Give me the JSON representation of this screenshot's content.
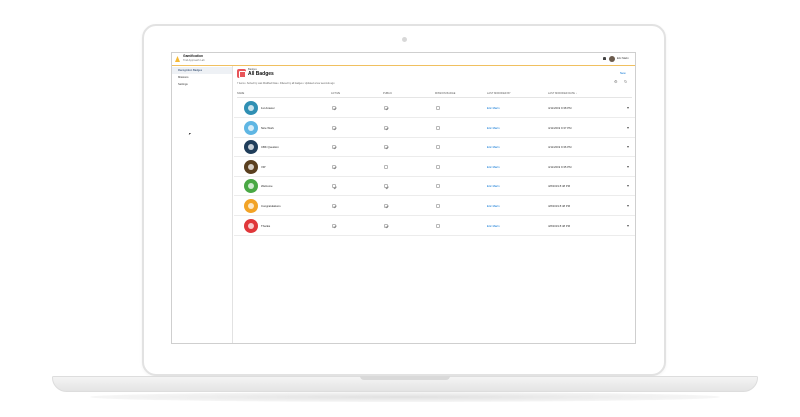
{
  "app": {
    "title": "Gamification",
    "subtitle": "Trail Approach Lab"
  },
  "header": {
    "user_name": "Eric Marin"
  },
  "sidebar": {
    "items": [
      {
        "label": "Recognition Badges",
        "active": true
      },
      {
        "label": "Missions",
        "active": false
      },
      {
        "label": "Settings",
        "active": false
      }
    ]
  },
  "list": {
    "object_label": "Badges",
    "title": "All Badges",
    "new_label": "New",
    "meta": "7 items • Sorted by Last Modified Date • Filtered by all badges • Updated a few seconds ago"
  },
  "table": {
    "columns": [
      "NAME",
      "ACTIVE",
      "PUBLIC",
      "MISSION BADGE",
      "LAST MODIFIED BY",
      "LAST MODIFIED DATE ↓"
    ],
    "rows": [
      {
        "name": "1st Answer",
        "active": true,
        "public": true,
        "mission": false,
        "modified_by": "Eric Marin",
        "modified_date": "4/11/2019 9:38 PM",
        "color": "#2f8fb3"
      },
      {
        "name": "Nice Work",
        "active": true,
        "public": true,
        "mission": false,
        "modified_by": "Eric Marin",
        "modified_date": "4/11/2019 9:37 PM",
        "color": "#5fb6e3"
      },
      {
        "name": "CBK Question",
        "active": true,
        "public": true,
        "mission": false,
        "modified_by": "Eric Marin",
        "modified_date": "4/11/2019 9:36 PM",
        "color": "#1f3d5a"
      },
      {
        "name": "VIP",
        "active": true,
        "public": false,
        "mission": false,
        "modified_by": "Eric Marin",
        "modified_date": "4/11/2019 9:35 PM",
        "color": "#5a3f1f"
      },
      {
        "name": "Welcome",
        "active": true,
        "public": true,
        "mission": false,
        "modified_by": "Eric Marin",
        "modified_date": "4/8/2019 8:48 PM",
        "color": "#49a844"
      },
      {
        "name": "Congratulations",
        "active": true,
        "public": true,
        "mission": false,
        "modified_by": "Eric Marin",
        "modified_date": "4/8/2019 8:48 PM",
        "color": "#f2a326"
      },
      {
        "name": "Thanks",
        "active": true,
        "public": true,
        "mission": false,
        "modified_by": "Eric Marin",
        "modified_date": "4/8/2019 8:48 PM",
        "color": "#e0373a"
      }
    ]
  }
}
